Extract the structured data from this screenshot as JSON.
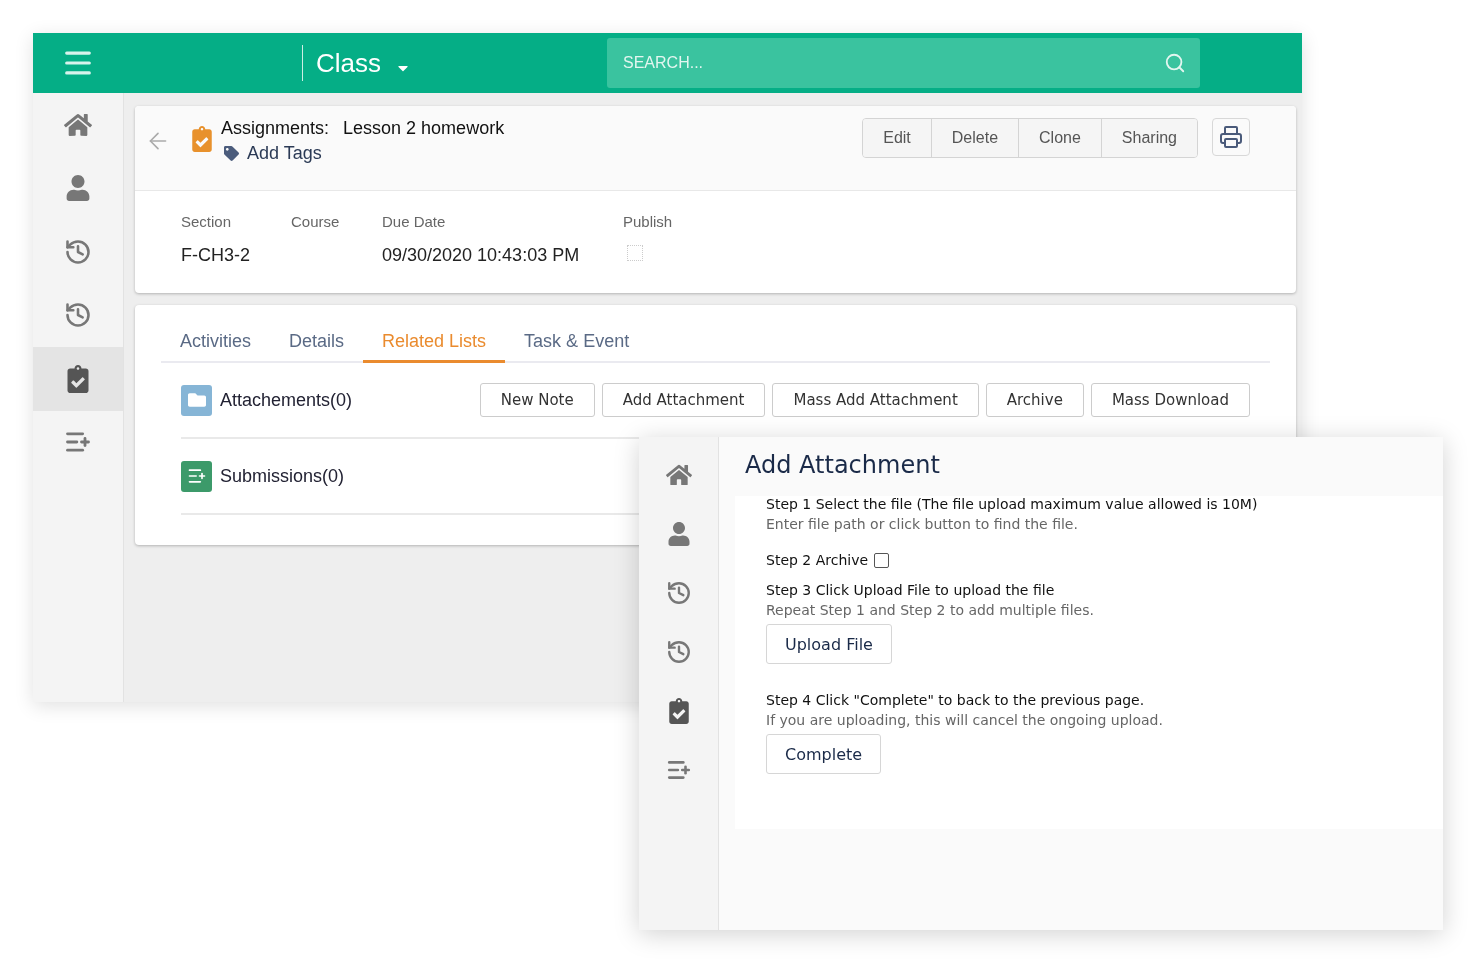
{
  "main_window": {
    "header": {
      "title": "Class",
      "search": {
        "placeholder": "SEARCH..."
      }
    },
    "sidebar": {
      "items": [
        {
          "kind": "home",
          "selected": false
        },
        {
          "kind": "user",
          "selected": false
        },
        {
          "kind": "history",
          "selected": false
        },
        {
          "kind": "history",
          "selected": false
        },
        {
          "kind": "assignment",
          "selected": true
        },
        {
          "kind": "list",
          "selected": false
        }
      ]
    },
    "record": {
      "type_label": "Assignments:",
      "name": "Lesson 2 homework",
      "add_tags": "Add Tags",
      "actions": [
        "Edit",
        "Delete",
        "Clone",
        "Sharing"
      ],
      "fields": [
        {
          "kind": "text",
          "label": "Section",
          "value": "F-CH3-2"
        },
        {
          "kind": "text",
          "label": "Course"
        },
        {
          "kind": "text",
          "label": "Due Date",
          "value": "09/30/2020 10:43:03 PM"
        },
        {
          "kind": "checkbox",
          "label": "Publish",
          "checked": false
        }
      ]
    },
    "tabs": [
      {
        "label": "Activities",
        "selected": false
      },
      {
        "label": "Details",
        "selected": false
      },
      {
        "label": "Related Lists",
        "selected": true
      },
      {
        "label": "Task & Event",
        "selected": false
      }
    ],
    "related_lists": [
      {
        "kind": "attachments",
        "title": "Attachements(0)",
        "buttons": [
          "New Note",
          "Add Attachment",
          "Mass Add Attachment",
          "Archive",
          "Mass Download"
        ]
      },
      {
        "kind": "submissions",
        "title": "Submissions(0)"
      }
    ]
  },
  "dialog": {
    "sidebar": {
      "items": [
        {
          "kind": "home",
          "selected": false
        },
        {
          "kind": "user",
          "selected": false
        },
        {
          "kind": "history",
          "selected": false
        },
        {
          "kind": "history",
          "selected": false
        },
        {
          "kind": "assignment",
          "selected": false
        },
        {
          "kind": "list",
          "selected": false
        }
      ]
    },
    "title": "Add Attachment",
    "steps": [
      {
        "title": "Step 1 Select the file  (The file upload maximum value allowed is 10M)",
        "hint": "Enter file path or click button to find the file."
      },
      {
        "title": "Step 2 Archive",
        "checkbox": {
          "checked": false
        }
      },
      {
        "title": "Step 3 Click Upload File to upload the file",
        "hint": "Repeat Step 1 and Step 2 to add multiple files.",
        "button": "Upload File"
      },
      {
        "title": "Step 4 Click \"Complete\" to back to the previous page.",
        "hint": "If you are uploading, this will cancel the ongoing upload.",
        "button": "Complete"
      }
    ]
  }
}
